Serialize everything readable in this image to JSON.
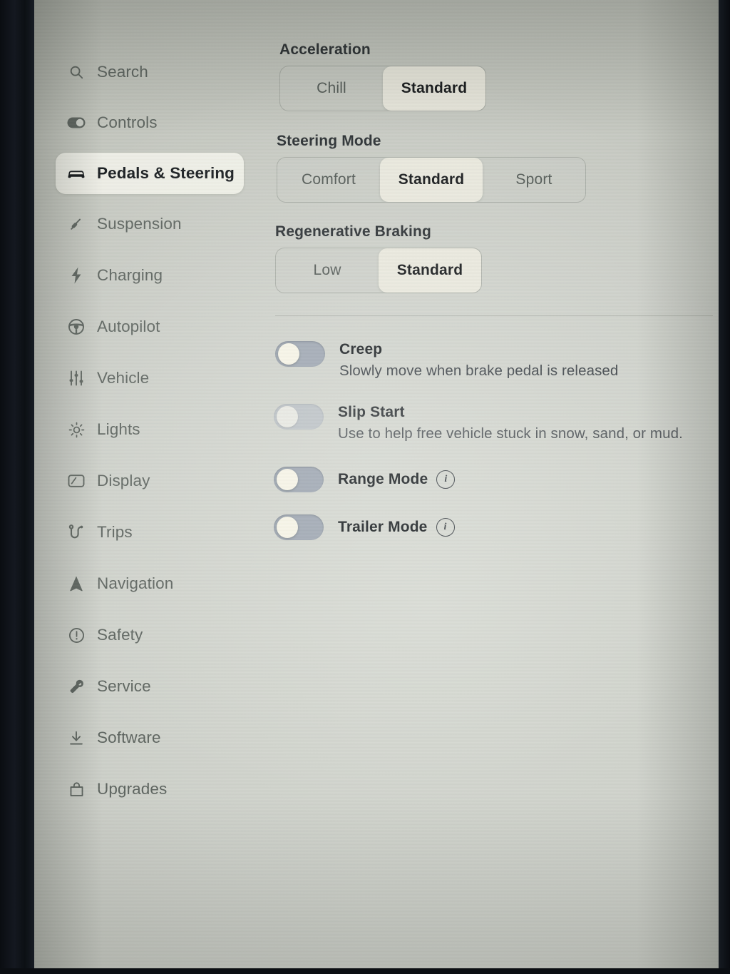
{
  "sidebar": {
    "items": [
      {
        "label": "Search",
        "icon": "search-icon",
        "selected": false
      },
      {
        "label": "Controls",
        "icon": "toggle-switch-icon",
        "selected": false
      },
      {
        "label": "Pedals & Steering",
        "icon": "car-front-icon",
        "selected": true
      },
      {
        "label": "Suspension",
        "icon": "shock-absorber-icon",
        "selected": false
      },
      {
        "label": "Charging",
        "icon": "lightning-bolt-icon",
        "selected": false
      },
      {
        "label": "Autopilot",
        "icon": "steering-wheel-icon",
        "selected": false
      },
      {
        "label": "Vehicle",
        "icon": "sliders-icon",
        "selected": false
      },
      {
        "label": "Lights",
        "icon": "sun-icon",
        "selected": false
      },
      {
        "label": "Display",
        "icon": "screen-icon",
        "selected": false
      },
      {
        "label": "Trips",
        "icon": "winding-road-icon",
        "selected": false
      },
      {
        "label": "Navigation",
        "icon": "navigation-arrow-icon",
        "selected": false
      },
      {
        "label": "Safety",
        "icon": "warning-circle-icon",
        "selected": false
      },
      {
        "label": "Service",
        "icon": "wrench-icon",
        "selected": false
      },
      {
        "label": "Software",
        "icon": "download-icon",
        "selected": false
      },
      {
        "label": "Upgrades",
        "icon": "shopping-bag-icon",
        "selected": false
      }
    ]
  },
  "main": {
    "acceleration": {
      "title": "Acceleration",
      "options": [
        "Chill",
        "Standard"
      ],
      "selected": "Standard"
    },
    "steering_mode": {
      "title": "Steering Mode",
      "options": [
        "Comfort",
        "Standard",
        "Sport"
      ],
      "selected": "Standard"
    },
    "regenerative_braking": {
      "title": "Regenerative Braking",
      "options": [
        "Low",
        "Standard"
      ],
      "selected": "Standard"
    },
    "toggles": [
      {
        "title": "Creep",
        "description": "Slowly move when brake pedal is released",
        "state": "off",
        "has_info": false
      },
      {
        "title": "Slip Start",
        "description": "Use to help free vehicle stuck in snow, sand, or mud.",
        "state": "off",
        "has_info": false
      },
      {
        "title": "Range Mode",
        "description": "",
        "state": "off",
        "has_info": true,
        "info_label": "i"
      },
      {
        "title": "Trailer Mode",
        "description": "",
        "state": "off",
        "has_info": true,
        "info_label": "i"
      }
    ]
  },
  "colors": {
    "screen_background": "#cfd2cb",
    "selected_segment": "#e9e8dd",
    "selected_nav": "#f7f6ee",
    "text_primary": "#1c2124",
    "text_secondary": "#5d645f",
    "switch_track": "#9ea7b2",
    "switch_knob": "#f6f4e6"
  }
}
